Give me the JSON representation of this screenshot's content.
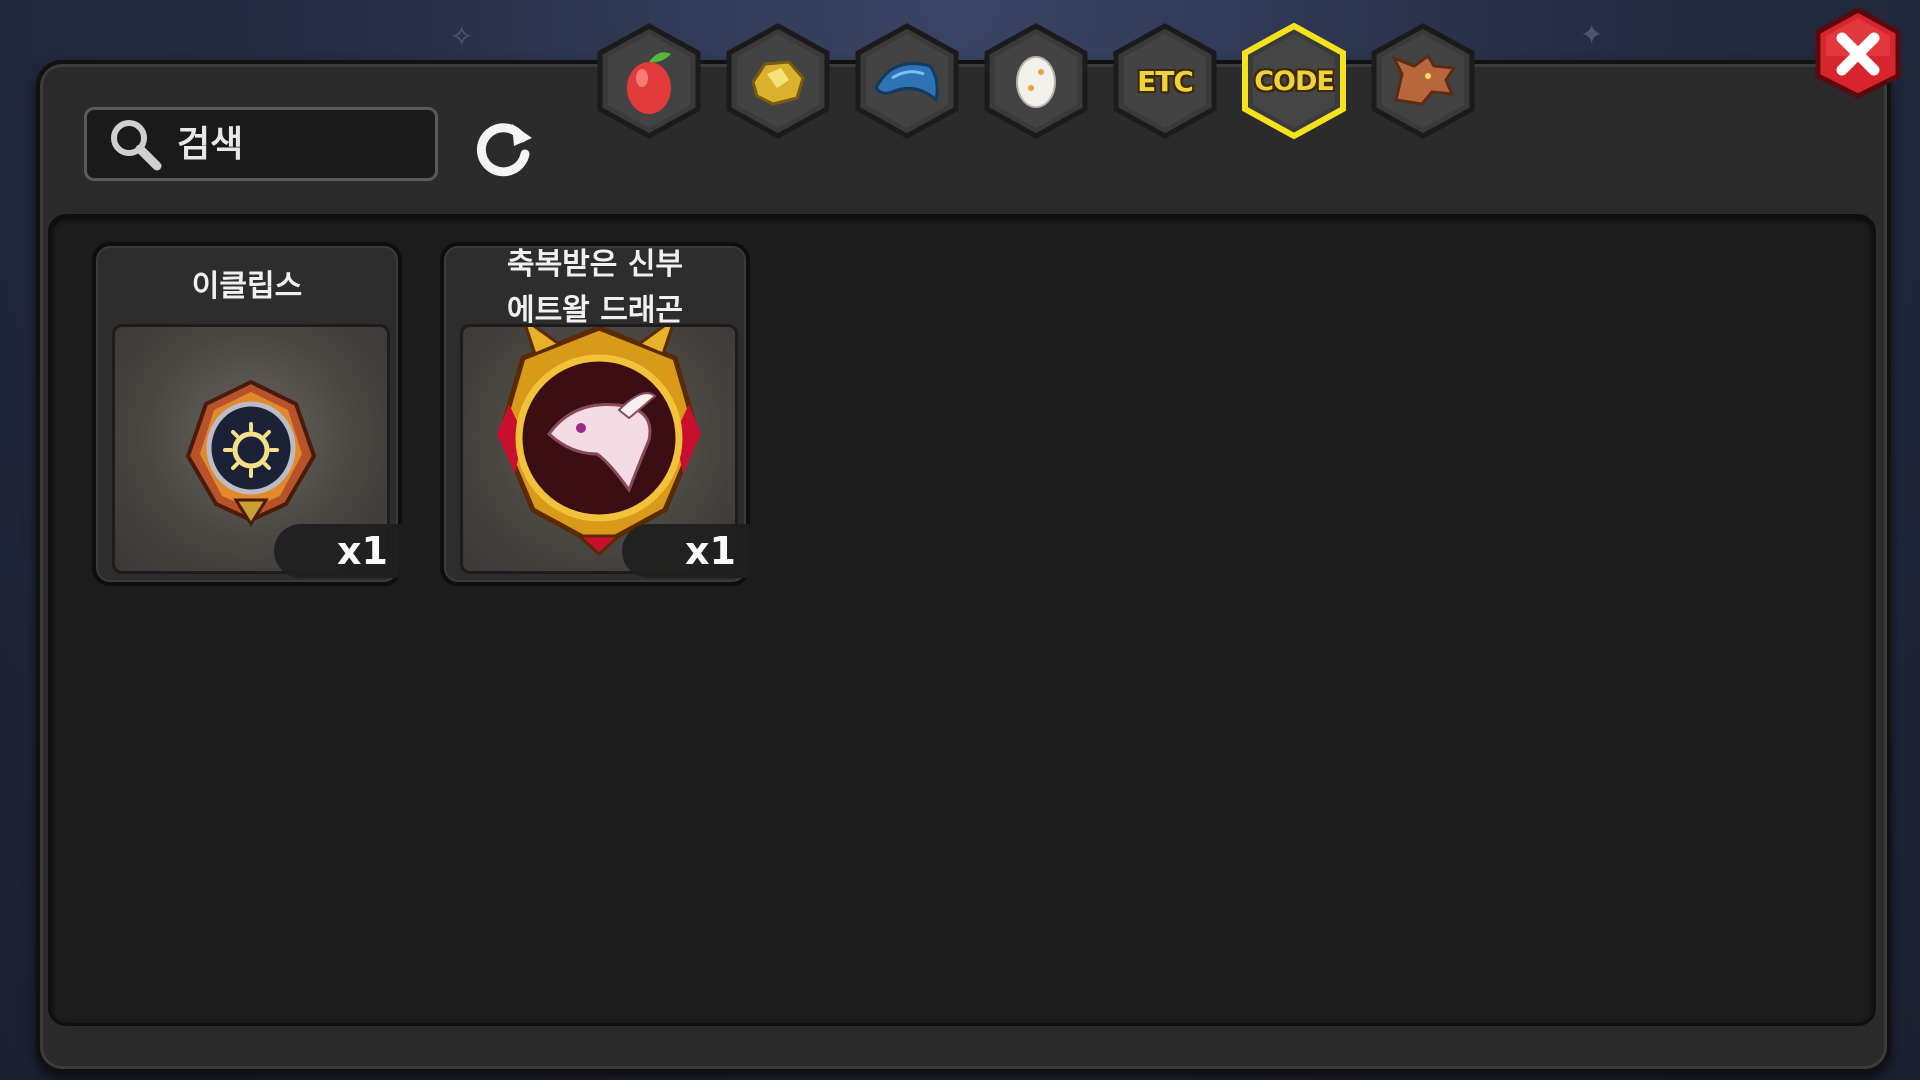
{
  "search": {
    "placeholder": "검색",
    "value": ""
  },
  "tabs": [
    {
      "icon": "fruit-icon",
      "label": "",
      "selected": false
    },
    {
      "icon": "gold-ore-icon",
      "label": "",
      "selected": false
    },
    {
      "icon": "dragon-scale-icon",
      "label": "",
      "selected": false
    },
    {
      "icon": "egg-icon",
      "label": "",
      "selected": false
    },
    {
      "icon": "",
      "label": "ETC",
      "selected": false
    },
    {
      "icon": "",
      "label": "CODE",
      "selected": true
    },
    {
      "icon": "dragon-head-icon",
      "label": "",
      "selected": false
    }
  ],
  "items": [
    {
      "name": "이클립스",
      "quantity": "x1",
      "icon": "eclipse-emblem-icon"
    },
    {
      "name_line1": "축복받은 신부",
      "name_line2": "에트왈 드래곤",
      "quantity": "x1",
      "icon": "dragon-emblem-icon"
    }
  ],
  "colors": {
    "panel": "#2b2b2b",
    "content": "#1c1c1c",
    "tab_selected_border": "#f5e21c",
    "tab_text": "#f2d23a",
    "close_button": "#d8242c"
  }
}
